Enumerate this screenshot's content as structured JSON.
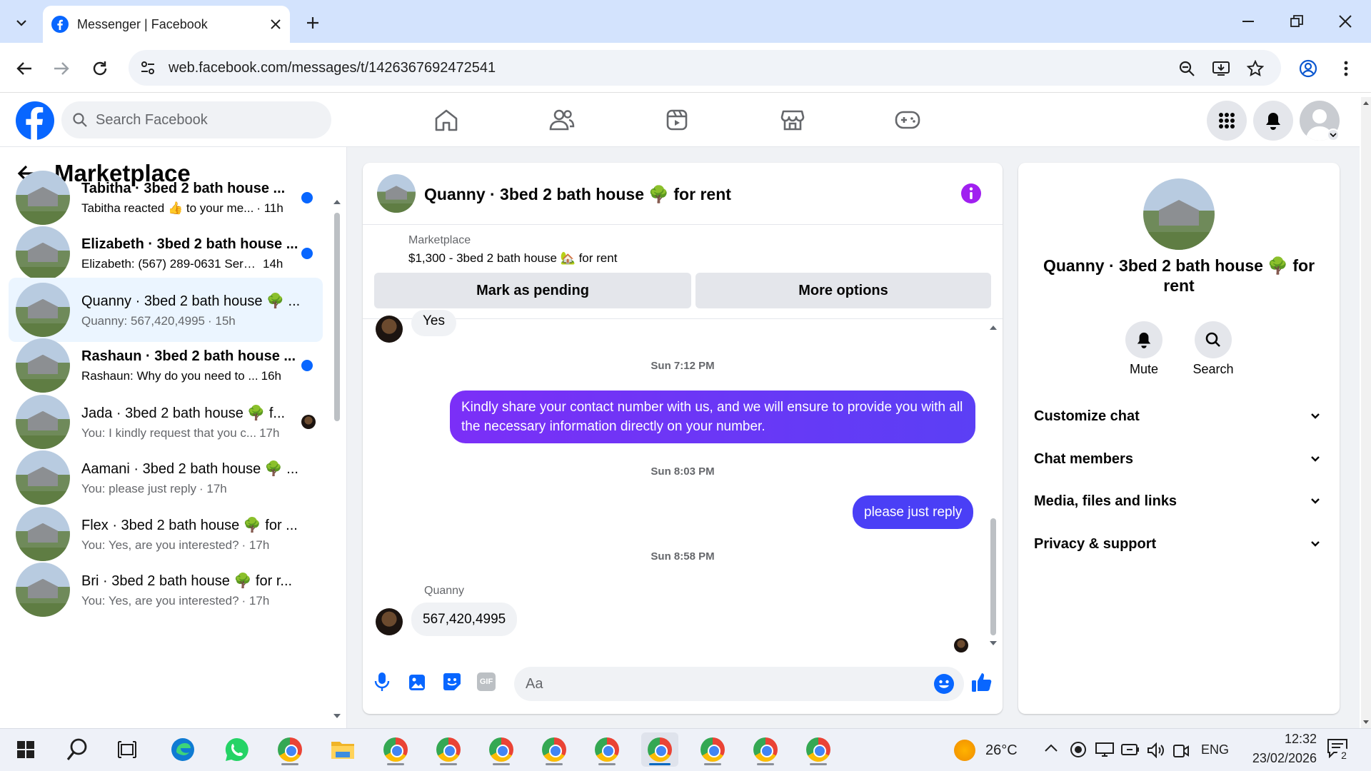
{
  "browser": {
    "tab_title": "Messenger | Facebook",
    "url": "web.facebook.com/messages/t/1426367692472541"
  },
  "fb": {
    "search_placeholder": "Search Facebook"
  },
  "sidebar": {
    "title": "Marketplace",
    "conversations": [
      {
        "name": "Tabitha · 3bed 2 bath house ...",
        "preview": "Tabitha reacted 👍 to your me...",
        "time": "· 11h",
        "unread": true
      },
      {
        "name": "Elizabeth · 3bed 2 bath house ...",
        "preview": "Elizabeth: (567) 289-0631 Sere...",
        "time": "14h",
        "unread": true
      },
      {
        "name": "Quanny · 3bed 2 bath house 🌳 ...",
        "preview": "Quanny: 567,420,4995",
        "time": "· 15h",
        "unread": false,
        "active": true
      },
      {
        "name": "Rashaun · 3bed 2 bath house ...",
        "preview": "Rashaun: Why do you need to ...",
        "time": "16h",
        "unread": true
      },
      {
        "name": "Jada · 3bed 2 bath house 🌳 f...",
        "preview": "You: I kindly request that you c...",
        "time": "17h",
        "unread": false
      },
      {
        "name": "Aamani · 3bed 2 bath house 🌳 ...",
        "preview": "You: please just reply",
        "time": "· 17h",
        "unread": false
      },
      {
        "name": "Flex · 3bed 2 bath house 🌳 for ...",
        "preview": "You: Yes, are you interested?",
        "time": "· 17h",
        "unread": false
      },
      {
        "name": "Bri · 3bed 2 bath house 🌳 for r...",
        "preview": "You: Yes, are you interested?",
        "time": "· 17h",
        "unread": false
      }
    ]
  },
  "chat": {
    "title": "Quanny · 3bed 2 bath house 🌳 for rent",
    "listing_label": "Marketplace",
    "listing_desc": "$1,300 - 3bed 2 bath house 🏡 for rent",
    "btn_pending": "Mark as pending",
    "btn_more": "More options",
    "msg_yes": "Yes",
    "ts1": "Sun 7:12 PM",
    "msg_out1": "Kindly share your contact number with us, and we will ensure to provide you with all the necessary information directly on your number.",
    "ts2": "Sun 8:03 PM",
    "msg_out2": "please just reply",
    "ts3": "Sun 8:58 PM",
    "sender": "Quanny",
    "msg_in": "567,420,4995",
    "composer_placeholder": "Aa",
    "gif_label": "GIF"
  },
  "info": {
    "name": "Quanny · 3bed 2 bath house 🌳 for rent",
    "mute": "Mute",
    "search": "Search",
    "sections": [
      "Customize chat",
      "Chat members",
      "Media, files and links",
      "Privacy & support"
    ]
  },
  "taskbar": {
    "temp": "26°C",
    "lang": "ENG",
    "time": "12:32",
    "date": "23/02/2026",
    "notif": "2"
  },
  "colors": {
    "fb_blue": "#0866ff",
    "bubble_purple": "#7b2ff7"
  }
}
